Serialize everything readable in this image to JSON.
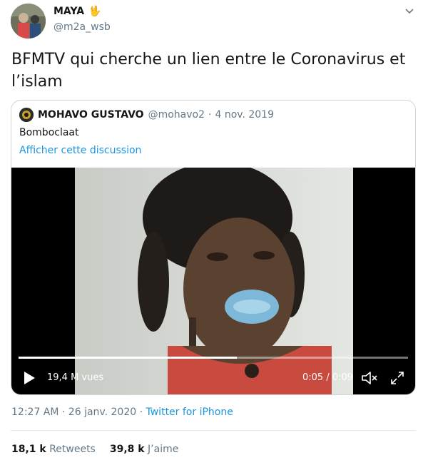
{
  "tweet": {
    "author_name": "MAYA",
    "author_emoji": "🖖",
    "author_handle": "@m2a_wsb",
    "text": "BFMTV qui cherche un lien entre le Coronavirus et l’islam",
    "timestamp": "12:27 AM · 26 janv. 2020",
    "source": "Twitter for iPhone",
    "retweets_count": "18,1 k",
    "retweets_label": "Retweets",
    "likes_count": "39,8 k",
    "likes_label": "J’aime"
  },
  "quote": {
    "name": "MOHAVO GUSTAVO",
    "handle": "@mohavo2",
    "separator": "·",
    "date": "4 nov. 2019",
    "text": "Bomboclaat",
    "thread_link": "Afficher cette discussion"
  },
  "video": {
    "views": "19,4 M vues",
    "time": "0:05 / 0:09",
    "progress": 0.56
  },
  "icons": {
    "caret": "chevron-down-icon",
    "play": "play-icon",
    "volume": "volume-muted-icon",
    "fullscreen": "fullscreen-icon"
  },
  "colors": {
    "link": "#1b95e0",
    "secondary_text": "#657786",
    "primary_text": "#14171a",
    "border": "#ccd6dd"
  }
}
